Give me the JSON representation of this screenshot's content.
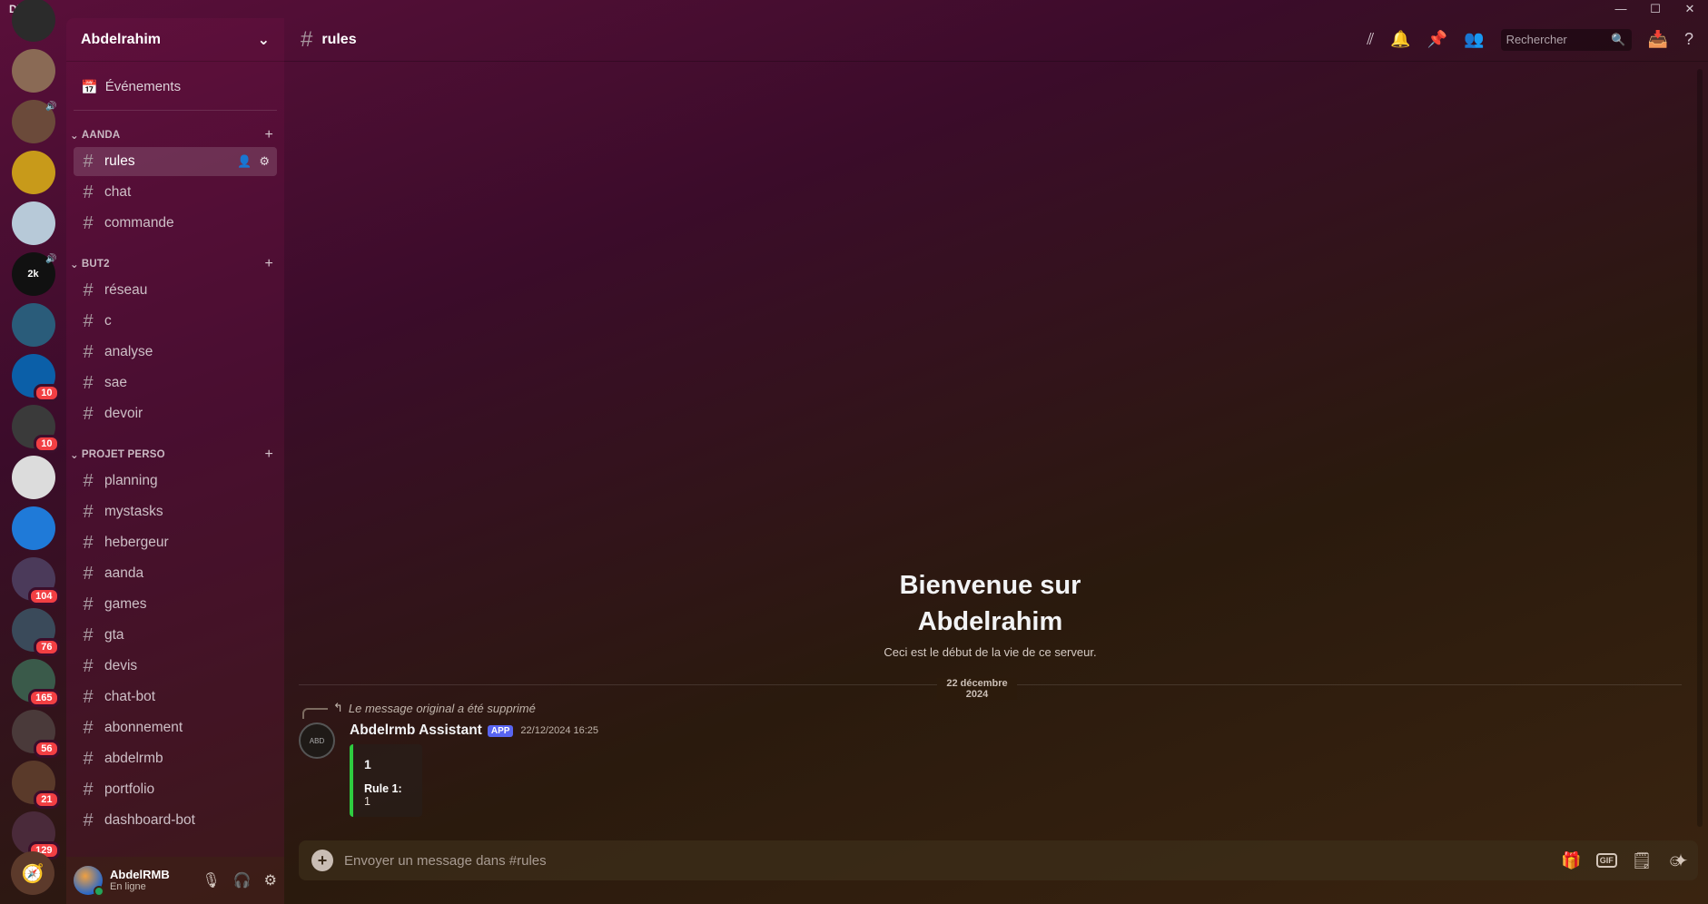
{
  "titlebar": {
    "app_name": "Discord",
    "minimize": "—",
    "maximize": "☐",
    "close": "✕"
  },
  "servers": [
    {
      "color": "#2b2b2b",
      "badge": "",
      "pill": false
    },
    {
      "color": "#8a6a55",
      "badge": "",
      "pill": true
    },
    {
      "color": "#6b4a3a",
      "badge": "",
      "pill": true,
      "vol": true
    },
    {
      "color": "#c89a1a",
      "badge": "",
      "pill": true
    },
    {
      "color": "#b7c9d8",
      "badge": "",
      "pill": true
    },
    {
      "color": "#111111",
      "badge": "",
      "pill": true,
      "vol": true,
      "label": "2k"
    },
    {
      "color": "#2a5c7a",
      "badge": "",
      "pill": false
    },
    {
      "color": "#0b5fa8",
      "badge": "10",
      "pill": true
    },
    {
      "color": "#3a3a3a",
      "badge": "10",
      "pill": true
    },
    {
      "color": "#dcdcdc",
      "badge": "",
      "pill": false
    },
    {
      "color": "#1f7ad8",
      "badge": "",
      "pill": true
    },
    {
      "color": "#4b3a5a",
      "badge": "104",
      "pill": true
    },
    {
      "color": "#3a4a5a",
      "badge": "76",
      "pill": true
    },
    {
      "color": "#3a5a4a",
      "badge": "165",
      "pill": true
    },
    {
      "color": "#4a3a3a",
      "badge": "56",
      "pill": true
    },
    {
      "color": "#5a3a2a",
      "badge": "21",
      "pill": true
    },
    {
      "color": "#4a2a3a",
      "badge": "129",
      "pill": true
    }
  ],
  "guild": {
    "name": "Abdelrahim"
  },
  "events_label": "Événements",
  "categories": [
    {
      "name": "AANDA",
      "channels": [
        "rules",
        "chat",
        "commande"
      ]
    },
    {
      "name": "BUT2",
      "channels": [
        "réseau",
        "c",
        "analyse",
        "sae",
        "devoir"
      ]
    },
    {
      "name": "PROJET PERSO",
      "channels": [
        "planning",
        "mystasks",
        "hebergeur",
        "aanda",
        "games",
        "gta",
        "devis",
        "chat-bot",
        "abonnement",
        "abdelrmb",
        "portfolio",
        "dashboard-bot"
      ]
    }
  ],
  "active_channel": "rules",
  "user": {
    "name": "AbdelRMB",
    "status": "En ligne"
  },
  "header": {
    "channel": "rules",
    "search_placeholder": "Rechercher"
  },
  "welcome": {
    "title_line1": "Bienvenue sur",
    "title_line2": "Abdelrahim",
    "subtitle": "Ceci est le début de la vie de ce serveur."
  },
  "date_divider": "22 décembre 2024",
  "message": {
    "reply_text": "Le message original a été supprimé",
    "author": "Abdelrmb Assistant",
    "tag": "APP",
    "timestamp": "22/12/2024 16:25",
    "embed_title": "1",
    "embed_field_name": "Rule 1:",
    "embed_field_value": "1",
    "embed_color": "#2ecc40"
  },
  "composer": {
    "placeholder": "Envoyer un message dans #rules",
    "gif_label": "GIF"
  }
}
